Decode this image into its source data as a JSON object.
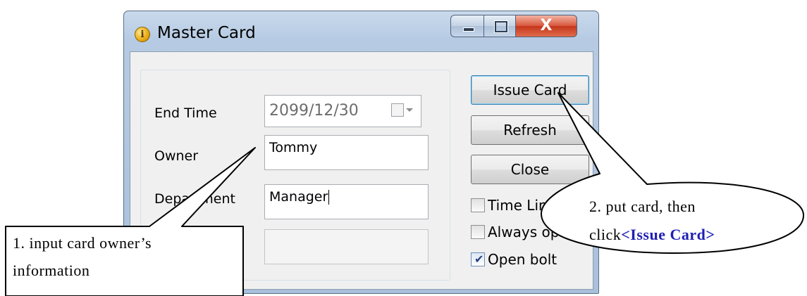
{
  "window": {
    "title": "Master Card",
    "icon_name": "info-icon",
    "controls": {
      "minimize": "minimize-icon",
      "maximize": "maximize-icon",
      "close": "X"
    }
  },
  "form": {
    "end_time": {
      "label": "End Time",
      "value": "2099/12/30"
    },
    "owner": {
      "label": "Owner",
      "value": "Tommy"
    },
    "department": {
      "label": "Department",
      "value": "Manager"
    },
    "fourth_field": {
      "label": "",
      "value": ""
    }
  },
  "buttons": {
    "issue_card": "Issue Card",
    "refresh": "Refresh",
    "close": "Close"
  },
  "checkboxes": [
    {
      "label": "Time Limit",
      "checked": false
    },
    {
      "label": "Always open",
      "checked": false
    },
    {
      "label": "Open bolt",
      "checked": true
    }
  ],
  "callouts": {
    "left_line1": "1. input card owner’s",
    "left_line2": "information",
    "right_line1": "2. put card, then",
    "right_prefix": "click",
    "right_emphasis": "<Issue Card>"
  },
  "colors": {
    "callout_emphasis": "#1f1fb3",
    "close_button": "#c4361c"
  }
}
